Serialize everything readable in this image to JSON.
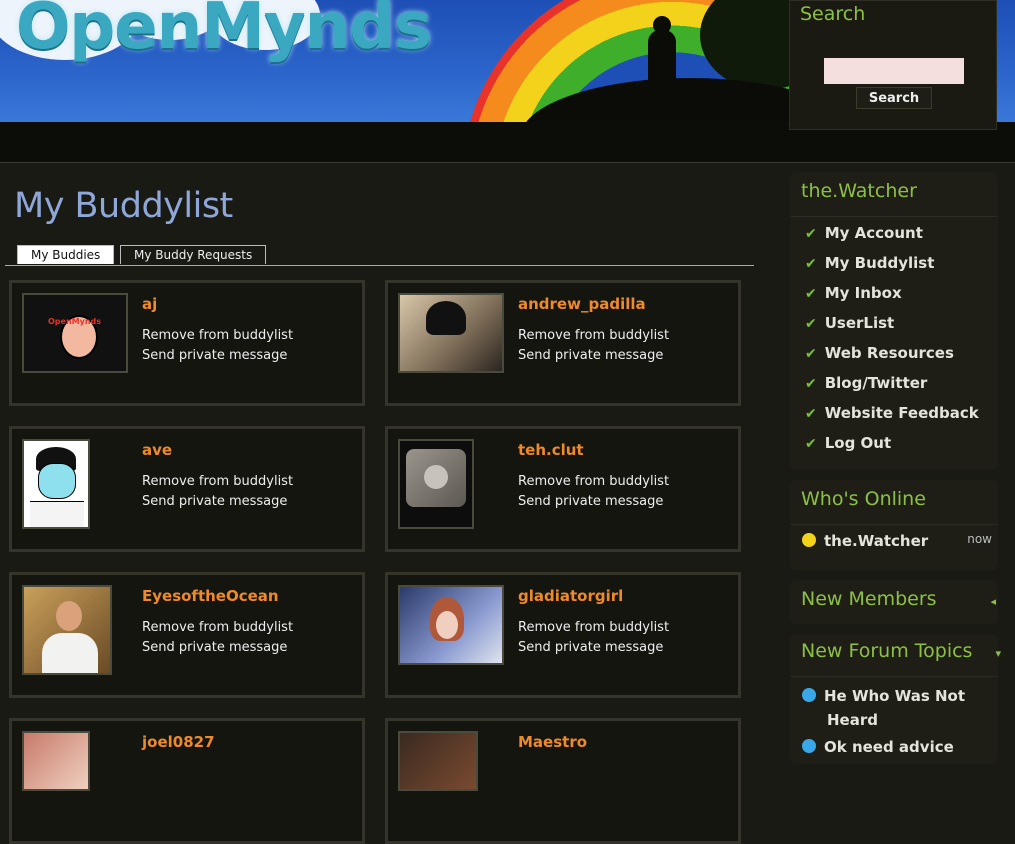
{
  "site": {
    "logo": "OpenMynds"
  },
  "search": {
    "title": "Search",
    "placeholder": "",
    "button": "Search"
  },
  "page": {
    "title": "My Buddylist"
  },
  "tabs": [
    {
      "label": "My Buddies",
      "active": true
    },
    {
      "label": "My Buddy Requests",
      "active": false
    }
  ],
  "actions": {
    "remove": "Remove from buddylist",
    "message": "Send private message"
  },
  "buddies": [
    {
      "name": "aj",
      "avatar": "openmynds-cartoon-avatar"
    },
    {
      "name": "andrew_padilla",
      "avatar": "photo-avatar"
    },
    {
      "name": "ave",
      "avatar": "cartoon-glasses-avatar"
    },
    {
      "name": "teh.clut",
      "avatar": "companion-cube-avatar"
    },
    {
      "name": "EyesoftheOcean",
      "avatar": "photo-avatar"
    },
    {
      "name": "gladiatorgirl",
      "avatar": "photo-avatar"
    },
    {
      "name": "joel0827",
      "avatar": "photo-avatar"
    },
    {
      "name": "Maestro",
      "avatar": "photo-avatar"
    }
  ],
  "sidebar": {
    "user_block": {
      "title": "the.Watcher",
      "items": [
        {
          "label": "My Account"
        },
        {
          "label": "My Buddylist"
        },
        {
          "label": "My Inbox"
        },
        {
          "label": "UserList"
        },
        {
          "label": "Web Resources"
        },
        {
          "label": "Blog/Twitter"
        },
        {
          "label": "Website Feedback"
        },
        {
          "label": "Log Out"
        }
      ]
    },
    "whos_online": {
      "title": "Who's Online",
      "users": [
        {
          "name": "the.Watcher",
          "when": "now"
        }
      ]
    },
    "new_members": {
      "title": "New Members"
    },
    "forum_topics": {
      "title": "New Forum Topics",
      "items": [
        {
          "line1": "He Who Was Not",
          "line2": "Heard"
        },
        {
          "line1": "Ok need advice"
        }
      ]
    }
  },
  "colors": {
    "accent": "#8cc045",
    "name": "#ef8a2a",
    "title": "#8fa7d8"
  }
}
